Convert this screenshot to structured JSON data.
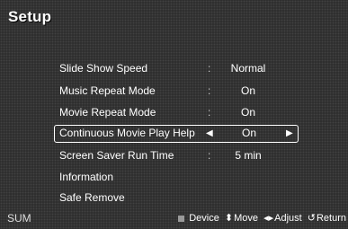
{
  "title": "Setup",
  "menu": [
    {
      "label": "Slide Show Speed",
      "value": "Normal"
    },
    {
      "label": "Music Repeat Mode",
      "value": "On"
    },
    {
      "label": "Movie Repeat Mode",
      "value": "On"
    },
    {
      "label": "Continuous Movie Play Help",
      "value": "On"
    },
    {
      "label": "Screen Saver Run Time",
      "value": "5 min"
    },
    {
      "label": "Information",
      "value": ""
    },
    {
      "label": "Safe Remove",
      "value": ""
    }
  ],
  "separator": ":",
  "arrows": {
    "left": "◀",
    "right": "▶"
  },
  "footer": {
    "source": "SUM",
    "device": "Device",
    "move": "Move",
    "adjust": "Adjust",
    "return": "Return",
    "move_icon": "⬍",
    "adjust_icon": "◂▸",
    "return_icon": "↺"
  },
  "colors": {
    "background": "#2b2b2b",
    "text": "#ffffff"
  }
}
